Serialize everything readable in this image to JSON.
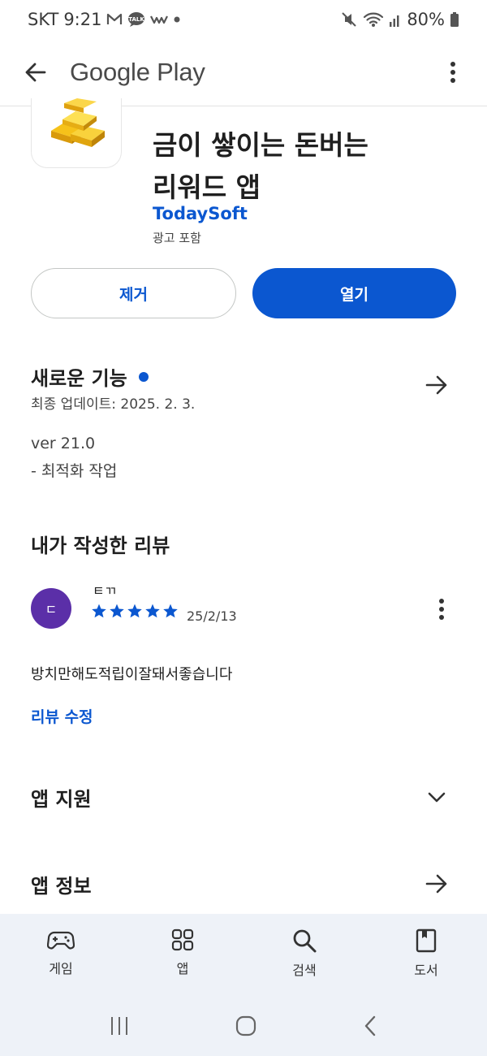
{
  "status_bar": {
    "carrier": "SKT",
    "time": "9:21",
    "battery": "80%"
  },
  "app_bar": {
    "title": "Google Play"
  },
  "app": {
    "title_line1": "금이 쌓이는 돈버는",
    "title_line2": "리워드 앱",
    "developer": "TodaySoft",
    "ads_label": "광고 포함"
  },
  "actions": {
    "uninstall_label": "제거",
    "open_label": "열기"
  },
  "whats_new": {
    "title": "새로운 기능",
    "updated": "최종 업데이트: 2025. 2. 3.",
    "version": "ver 21.0",
    "note": "- 최적화 작업"
  },
  "my_review": {
    "section_title": "내가 작성한 리뷰",
    "avatar_letter": "ㄷ",
    "reviewer_name": "ㅌㄲ",
    "rating": 5,
    "date": "25/2/13",
    "text": "방치만해도적립이잘돼서좋습니다",
    "edit_label": "리뷰 수정"
  },
  "app_support": {
    "title": "앱 지원"
  },
  "app_info": {
    "title": "앱 정보"
  },
  "bottom_nav": {
    "games": "게임",
    "apps": "앱",
    "search": "검색",
    "books": "도서"
  },
  "colors": {
    "accent": "#0b57d0",
    "avatar": "#5b2fa8",
    "nav_bg": "#eef2f8"
  },
  "icons": [
    "back-arrow-icon",
    "more-vert-icon",
    "gold-bars-icon",
    "arrow-right-icon",
    "chevron-down-icon",
    "star-icon",
    "gamepad-icon",
    "apps-grid-icon",
    "search-icon",
    "book-icon",
    "recents-icon",
    "home-icon",
    "back-nav-icon",
    "mail-icon",
    "talk-icon",
    "mute-icon",
    "wifi-icon",
    "signal-icon",
    "battery-icon"
  ]
}
